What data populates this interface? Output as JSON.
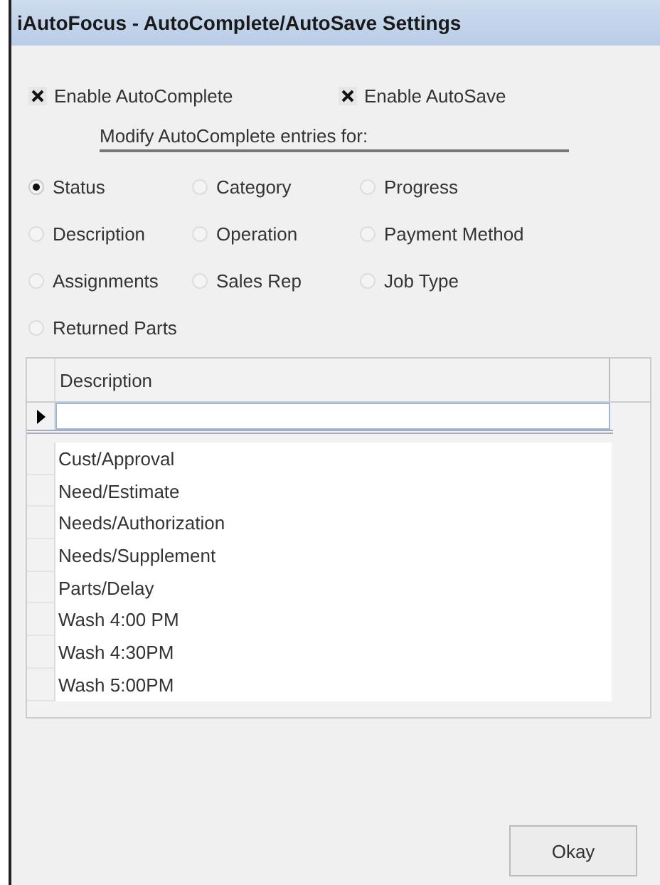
{
  "window": {
    "title": "iAutoFocus - AutoComplete/AutoSave Settings"
  },
  "checkboxes": [
    {
      "label": "Enable AutoComplete",
      "checked": true
    },
    {
      "label": "Enable AutoSave",
      "checked": true
    }
  ],
  "group_label": "Modify AutoComplete entries for:",
  "options": [
    {
      "label": "Status",
      "selected": true
    },
    {
      "label": "Category",
      "selected": false
    },
    {
      "label": "Progress",
      "selected": false
    },
    {
      "label": "Description",
      "selected": false
    },
    {
      "label": "Operation",
      "selected": false
    },
    {
      "label": "Payment Method",
      "selected": false
    },
    {
      "label": "Assignments",
      "selected": false
    },
    {
      "label": "Sales Rep",
      "selected": false
    },
    {
      "label": "Job Type",
      "selected": false
    },
    {
      "label": "Returned Parts",
      "selected": false
    }
  ],
  "grid": {
    "columns": [
      "Description"
    ],
    "rows": [
      "Cust/Approval",
      "Need/Estimate",
      "Needs/Authorization",
      "Needs/Supplement",
      "Parts/Delay",
      "Wash 4:00 PM",
      "Wash 4:30PM",
      "Wash 5:00PM"
    ]
  },
  "buttons": [
    "Okay"
  ]
}
